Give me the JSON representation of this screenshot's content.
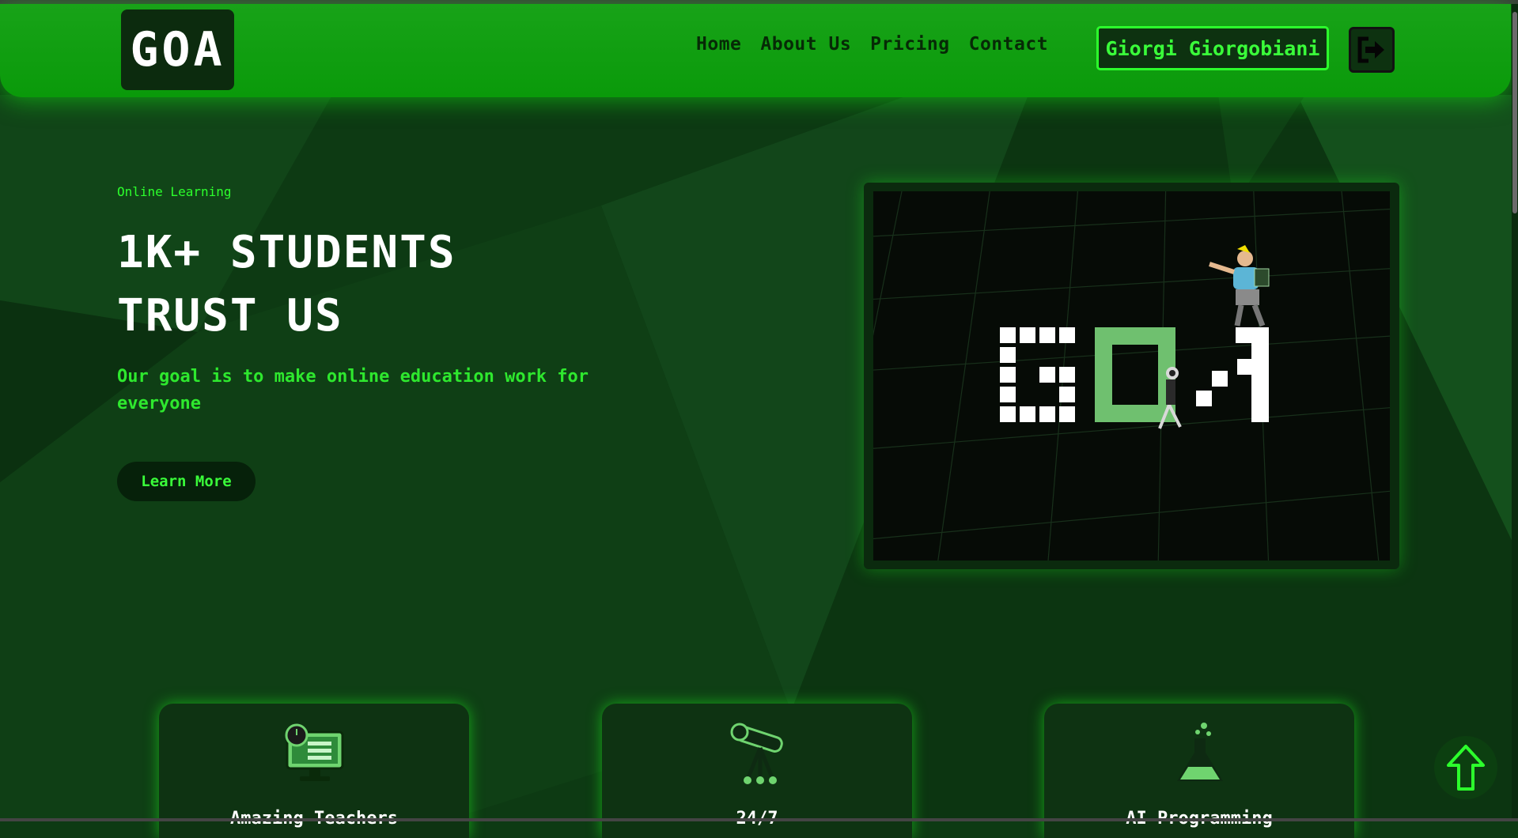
{
  "header": {
    "logo": "GOA",
    "nav": [
      "Home",
      "About Us",
      "Pricing",
      "Contact"
    ],
    "user_name": "Giorgi Giorgobiani",
    "logout_icon": "logout-icon"
  },
  "hero": {
    "eyebrow": "Online Learning",
    "title_line1": "1K+ STUDENTS",
    "title_line2": "TRUST US",
    "subtitle": "Our goal is to make online education work for everyone",
    "cta": "Learn More",
    "image_logo": "GOA"
  },
  "features": [
    {
      "icon": "monitor-checklist-icon",
      "label": "Amazing Teachers"
    },
    {
      "icon": "telescope-icon",
      "label": "24/7"
    },
    {
      "icon": "flask-icon",
      "label": "AI Programming"
    }
  ],
  "colors": {
    "accent": "#2cff2c",
    "header": "#0a9a0a",
    "background": "#0d3a13",
    "card": "#0e3312"
  },
  "scroll_top_icon": "arrow-up-icon"
}
